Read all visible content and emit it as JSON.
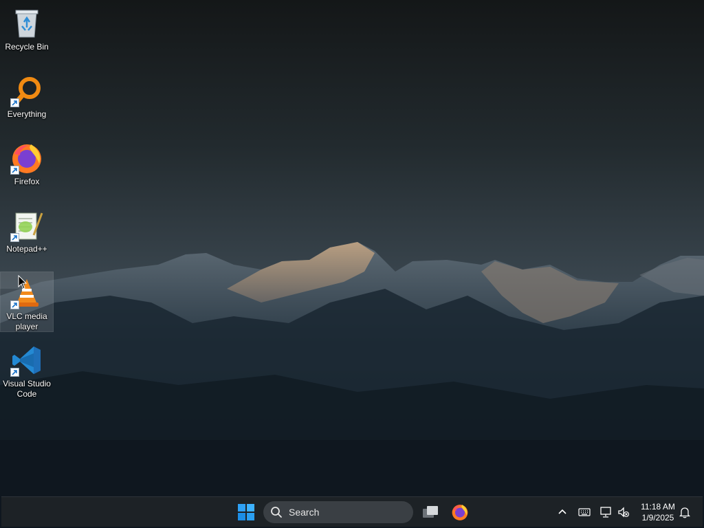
{
  "desktop_icons": [
    {
      "label": "Recycle Bin",
      "icon": "recycle-bin-icon"
    },
    {
      "label": "Everything",
      "icon": "everything-search-icon"
    },
    {
      "label": "Firefox",
      "icon": "firefox-icon"
    },
    {
      "label": "Notepad++",
      "icon": "notepad-plus-plus-icon"
    },
    {
      "label": "VLC media player",
      "icon": "vlc-icon"
    },
    {
      "label": "Visual Studio Code",
      "icon": "vscode-icon"
    }
  ],
  "taskbar": {
    "search_placeholder": "Search",
    "pinned": [
      "task-view-icon",
      "firefox-icon"
    ],
    "tray_icons": [
      "chevron-up-icon",
      "keyboard-icon",
      "network-icon",
      "volume-muted-icon",
      "notification-bell-icon"
    ]
  },
  "clock": {
    "time": "11:18 AM",
    "date": "1/9/2025"
  },
  "colors": {
    "accent": "#0078d4",
    "taskbar": "#1d2226",
    "search": "#3a3f44"
  }
}
